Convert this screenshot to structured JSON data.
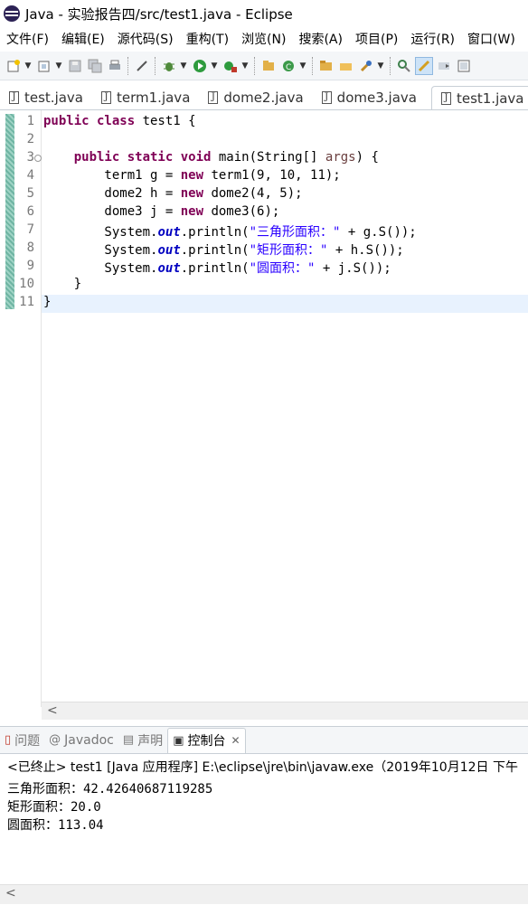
{
  "window": {
    "title": "Java  -  实验报告四/src/test1.java  -  Eclipse"
  },
  "menubar": {
    "items": [
      "文件(F)",
      "编辑(E)",
      "源代码(S)",
      "重构(T)",
      "浏览(N)",
      "搜索(A)",
      "项目(P)",
      "运行(R)",
      "窗口(W)"
    ]
  },
  "toolbar": {
    "icons": [
      "new-icon",
      "new-type-icon",
      "save-icon",
      "save-all-icon",
      "print-icon",
      "toggle-mark-icon",
      "debug-icon",
      "run-icon",
      "external-tools-icon",
      "new-java-project-icon",
      "new-class-icon",
      "open-type-icon",
      "open-task-icon",
      "search-icon",
      "annotation-icon",
      "highlight-icon",
      "prev-edit-icon",
      "maximize-icon"
    ]
  },
  "editor_tabs": [
    {
      "label": "test.java"
    },
    {
      "label": "term1.java"
    },
    {
      "label": "dome2.java"
    },
    {
      "label": "dome3.java"
    },
    {
      "label": "test1.java",
      "active": true
    }
  ],
  "code": {
    "line_numbers": [
      "1",
      "2",
      "3",
      "4",
      "5",
      "6",
      "7",
      "8",
      "9",
      "10",
      "11"
    ],
    "lines": [
      [
        {
          "t": "public class ",
          "c": "kw"
        },
        {
          "t": "test1 {",
          "c": ""
        }
      ],
      [],
      [
        {
          "t": "    ",
          "c": ""
        },
        {
          "t": "public static void ",
          "c": "kw"
        },
        {
          "t": "main(String[] ",
          "c": ""
        },
        {
          "t": "args",
          "c": "prm"
        },
        {
          "t": ") {",
          "c": ""
        }
      ],
      [
        {
          "t": "        term1 g = ",
          "c": ""
        },
        {
          "t": "new ",
          "c": "kw"
        },
        {
          "t": "term1(9, 10, 11);",
          "c": ""
        }
      ],
      [
        {
          "t": "        dome2 h = ",
          "c": ""
        },
        {
          "t": "new ",
          "c": "kw"
        },
        {
          "t": "dome2(4, 5);",
          "c": ""
        }
      ],
      [
        {
          "t": "        dome3 j = ",
          "c": ""
        },
        {
          "t": "new ",
          "c": "kw"
        },
        {
          "t": "dome3(6);",
          "c": ""
        }
      ],
      [
        {
          "t": "        System.",
          "c": ""
        },
        {
          "t": "out",
          "c": "fld"
        },
        {
          "t": ".println(",
          "c": ""
        },
        {
          "t": "\"三角形面积：\"",
          "c": "str"
        },
        {
          "t": " + g.S());",
          "c": ""
        }
      ],
      [
        {
          "t": "        System.",
          "c": ""
        },
        {
          "t": "out",
          "c": "fld"
        },
        {
          "t": ".println(",
          "c": ""
        },
        {
          "t": "\"矩形面积：\"",
          "c": "str"
        },
        {
          "t": " + h.S());",
          "c": ""
        }
      ],
      [
        {
          "t": "        System.",
          "c": ""
        },
        {
          "t": "out",
          "c": "fld"
        },
        {
          "t": ".println(",
          "c": ""
        },
        {
          "t": "\"圆面积：\"",
          "c": "str"
        },
        {
          "t": " + j.S());",
          "c": ""
        }
      ],
      [
        {
          "t": "    }",
          "c": ""
        }
      ],
      [
        {
          "t": "}",
          "c": ""
        }
      ]
    ],
    "current_line": 11,
    "fold_line": 3
  },
  "bottom_tabs": [
    {
      "label": "问题",
      "icon": "problems-icon"
    },
    {
      "label": "Javadoc",
      "icon": "javadoc-icon"
    },
    {
      "label": "声明",
      "icon": "declaration-icon"
    },
    {
      "label": "控制台",
      "icon": "console-icon",
      "active": true
    }
  ],
  "console": {
    "header": "<已终止> test1 [Java 应用程序] E:\\eclipse\\jre\\bin\\javaw.exe（2019年10月12日 下午",
    "output": [
      "三角形面积：42.42640687119285",
      "矩形面积：20.0",
      "圆面积：113.04"
    ]
  }
}
